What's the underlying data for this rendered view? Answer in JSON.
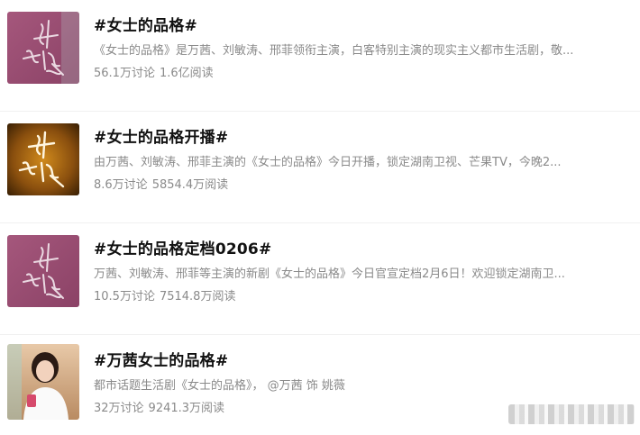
{
  "topics": [
    {
      "title": "#女士的品格#",
      "desc": "《女士的品格》是万茜、刘敏涛、邢菲领衔主演，白客特别主演的现实主义都市生活剧，敬...",
      "discussions": "56.1万讨论",
      "reads": "1.6亿阅读",
      "thumb": {
        "type": "calligraphy",
        "bg": "#9a4f72",
        "text": "女士的品格"
      }
    },
    {
      "title": "#女士的品格开播#",
      "desc": "由万茜、刘敏涛、邢菲主演的《女士的品格》今日开播，锁定湖南卫视、芒果TV，今晚2...",
      "discussions": "8.6万讨论",
      "reads": "5854.4万阅读",
      "thumb": {
        "type": "calligraphy",
        "bg": "#7a4a12",
        "text": "女士的品格"
      }
    },
    {
      "title": "#女士的品格定档0206#",
      "desc": "万茜、刘敏涛、邢菲等主演的新剧《女士的品格》今日官宣定档2月6日！欢迎锁定湖南卫...",
      "discussions": "10.5万讨论",
      "reads": "7514.8万阅读",
      "thumb": {
        "type": "calligraphy",
        "bg": "#9a4f72",
        "text": "女士的品格"
      }
    },
    {
      "title": "#万茜女士的品格#",
      "desc": "都市话题生活剧《女士的品格》， @万茜 饰 姚薇",
      "discussions": "32万讨论",
      "reads": "9241.3万阅读",
      "thumb": {
        "type": "portrait",
        "bg": "#c9a27e"
      }
    }
  ]
}
